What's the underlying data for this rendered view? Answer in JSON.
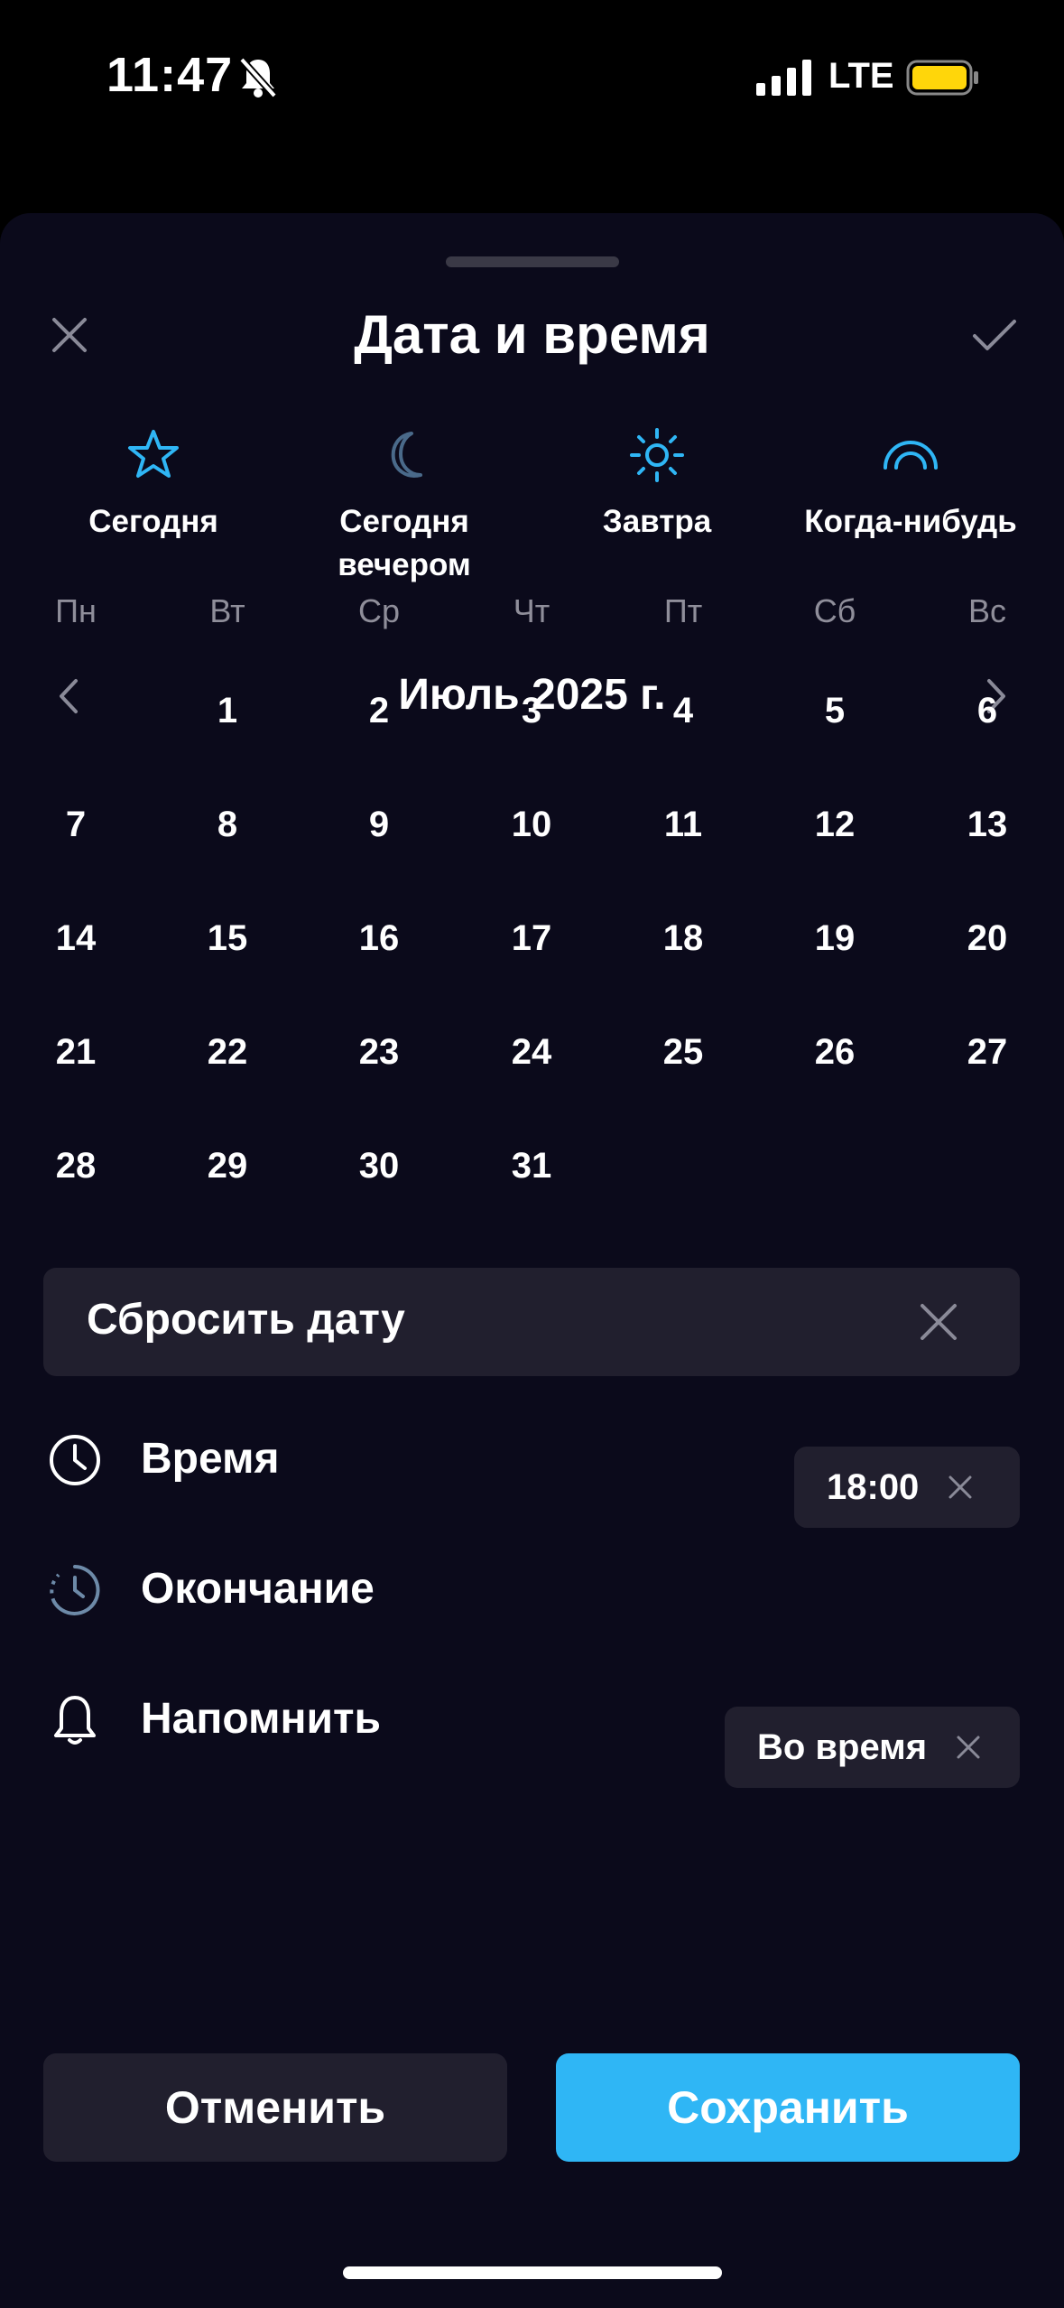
{
  "status_bar": {
    "time": "11:47",
    "network": "LTE"
  },
  "sheet": {
    "title": "Дата и время"
  },
  "quick_options": [
    {
      "label": "Сегодня",
      "icon": "star-icon"
    },
    {
      "label": "Сегодня вечером",
      "icon": "moon-icon"
    },
    {
      "label": "Завтра",
      "icon": "sun-icon"
    },
    {
      "label": "Когда-нибудь",
      "icon": "rainbow-icon"
    }
  ],
  "calendar": {
    "month_title": "Июль 2025 г.",
    "weekdays": [
      "Пн",
      "Вт",
      "Ср",
      "Чт",
      "Пт",
      "Сб",
      "Вс"
    ],
    "selected_day": "1",
    "days": [
      "1",
      "2",
      "3",
      "4",
      "5",
      "6",
      "7",
      "8",
      "9",
      "10",
      "11",
      "12",
      "13",
      "14",
      "15",
      "16",
      "17",
      "18",
      "19",
      "20",
      "21",
      "22",
      "23",
      "24",
      "25",
      "26",
      "27",
      "28",
      "29",
      "30",
      "31"
    ]
  },
  "reset": {
    "label": "Сбросить дату"
  },
  "time_row": {
    "label": "Время",
    "value": "18:00"
  },
  "end_row": {
    "label": "Окончание"
  },
  "remind_row": {
    "label": "Напомнить",
    "value": "Во время"
  },
  "actions": {
    "cancel": "Отменить",
    "save": "Сохранить"
  },
  "colors": {
    "accent": "#2fb6f5",
    "background": "#0b0a1b",
    "surface": "#211f2e",
    "muted_icon": "#4a6a8a"
  }
}
